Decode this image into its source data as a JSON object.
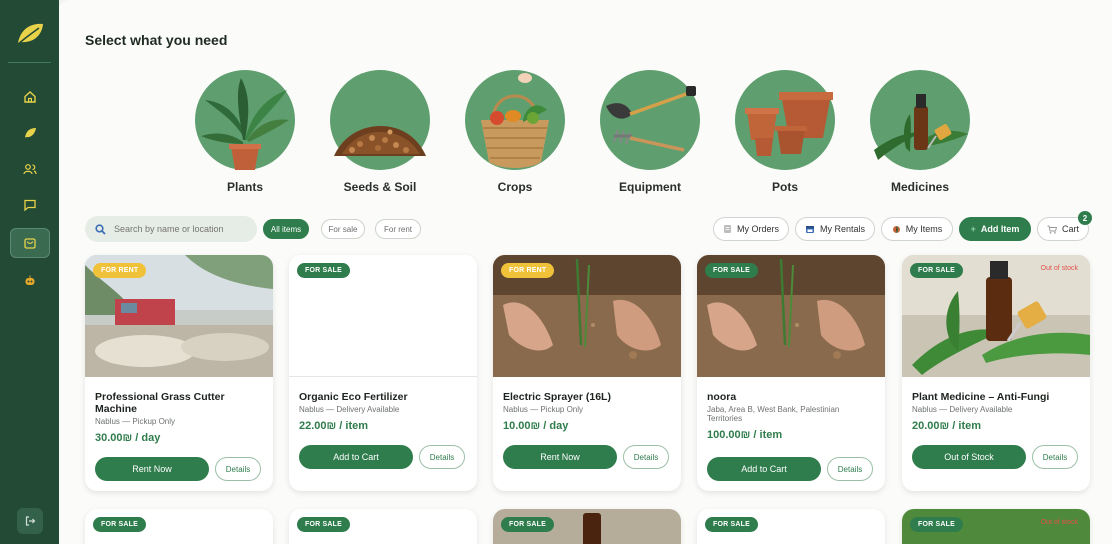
{
  "page": {
    "title": "Select what you need"
  },
  "sidebar": {
    "items": [
      {
        "icon": "home-icon"
      },
      {
        "icon": "leaf-icon"
      },
      {
        "icon": "users-icon"
      },
      {
        "icon": "chat-icon"
      },
      {
        "icon": "shop-icon"
      },
      {
        "icon": "bot-icon"
      }
    ],
    "logout_icon": "logout-icon"
  },
  "categories": [
    {
      "label": "Plants"
    },
    {
      "label": "Seeds & Soil"
    },
    {
      "label": "Crops"
    },
    {
      "label": "Equipment"
    },
    {
      "label": "Pots"
    },
    {
      "label": "Medicines"
    }
  ],
  "search": {
    "placeholder": "Search by name or location"
  },
  "filters": {
    "all": "All items",
    "sale": "For sale",
    "rent": "For rent"
  },
  "toolbar": {
    "orders": "My Orders",
    "rentals": "My Rentals",
    "items": "My Items",
    "add": "Add Item",
    "cart": "Cart",
    "cart_count": "2"
  },
  "products": [
    {
      "tag": "FOR RENT",
      "title": "Professional Grass Cutter Machine",
      "location": "Nablus — Pickup Only",
      "price": "30.00₪ / day",
      "action": "Rent Now",
      "details": "Details"
    },
    {
      "tag": "FOR SALE",
      "title": "Organic Eco Fertilizer",
      "location": "Nablus — Delivery Available",
      "price": "22.00₪ / item",
      "action": "Add to Cart",
      "details": "Details"
    },
    {
      "tag": "FOR RENT",
      "title": "Electric Sprayer (16L)",
      "location": "Nablus — Pickup Only",
      "price": "10.00₪ / day",
      "action": "Rent Now",
      "details": "Details"
    },
    {
      "tag": "FOR SALE",
      "title": "noora",
      "location": "Jaba, Area B, West Bank, Palestinian Territories",
      "price": "100.00₪ / item",
      "action": "Add to Cart",
      "details": "Details"
    },
    {
      "tag": "FOR SALE",
      "badge": "Out of stock",
      "title": "Plant Medicine – Anti-Fungi",
      "location": "Nablus — Delivery Available",
      "price": "20.00₪ / item",
      "action": "Out of Stock",
      "details": "Details"
    }
  ],
  "products_row2": [
    {
      "tag": "FOR SALE"
    },
    {
      "tag": "FOR SALE"
    },
    {
      "tag": "FOR SALE"
    },
    {
      "tag": "FOR SALE"
    },
    {
      "tag": "FOR SALE",
      "badge": "Out of stock"
    }
  ],
  "colors": {
    "sidebar": "#224a34",
    "accent": "#2f7c4c",
    "rent_tag": "#f0c23a",
    "category_circle": "#5f9f6f"
  }
}
